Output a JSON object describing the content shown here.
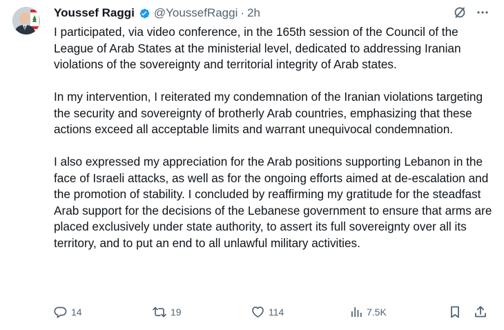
{
  "author": {
    "name": "Youssef Raggi",
    "handle": "@YoussefRaggi",
    "separator": "·",
    "time": "2h",
    "avatar_icon": "profile-photo",
    "verified_icon": "verified-badge-icon"
  },
  "header_actions": {
    "grok_icon": "grok-icon",
    "more_icon": "more-icon"
  },
  "tweet_text": {
    "paragraphs": [
      "I participated, via video conference, in the 165th session of the Council of the League of Arab States at the ministerial level, dedicated to addressing Iranian violations of the sovereignty and territorial integrity of Arab states.",
      "In my intervention, I reiterated my condemnation of the Iranian violations targeting the security and sovereignty of brotherly Arab countries, emphasizing that these actions exceed all acceptable limits and warrant unequivocal condemnation.",
      "I also expressed my appreciation for the Arab positions supporting Lebanon in the face of Israeli attacks, as well as for the ongoing efforts aimed at de-escalation and the promotion of stability. I concluded by reaffirming my gratitude for the steadfast Arab support for the decisions of the Lebanese government to ensure that arms are placed exclusively under state authority, to assert its full sovereignty over all its territory, and to put an end to all unlawful military activities."
    ]
  },
  "actions": {
    "reply": {
      "icon": "reply-icon",
      "count": "14"
    },
    "repost": {
      "icon": "repost-icon",
      "count": "19"
    },
    "like": {
      "icon": "heart-icon",
      "count": "114"
    },
    "views": {
      "icon": "views-icon",
      "count": "7.5K"
    },
    "bookmark": {
      "icon": "bookmark-icon"
    },
    "share": {
      "icon": "share-icon"
    }
  },
  "colors": {
    "text": "#0f1419",
    "secondary": "#536471",
    "verified": "#1d9bf0",
    "background": "#ffffff"
  }
}
